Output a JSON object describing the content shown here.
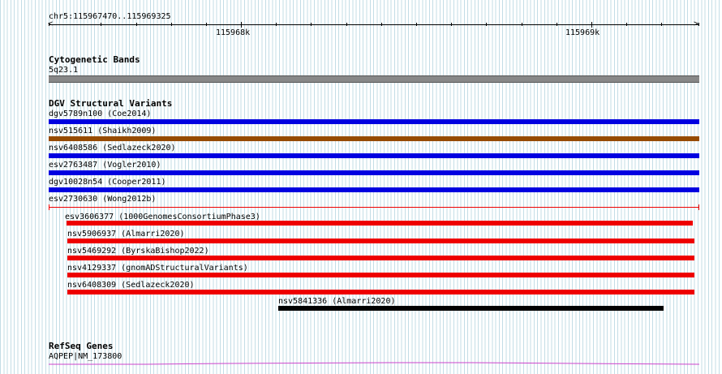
{
  "locus": "chr5:115967470..115969325",
  "ruler": {
    "labels": [
      "115968k",
      "115969k"
    ]
  },
  "tracks": {
    "cytoband": {
      "title": "Cytogenetic Bands",
      "band": "5q23.1",
      "band_color": "#888888"
    },
    "dgv": {
      "title": "DGV Structural Variants",
      "items": [
        {
          "label": "dgv5789n100 (Coe2014)",
          "color": "#0000e0"
        },
        {
          "label": "nsv515611 (Shaikh2009)",
          "color": "#964b00"
        },
        {
          "label": "nsv6408586 (Sedlazeck2020)",
          "color": "#0000e0"
        },
        {
          "label": "esv2763487 (Vogler2010)",
          "color": "#0000e0"
        },
        {
          "label": "dgv10028n54 (Cooper2011)",
          "color": "#0000e0"
        },
        {
          "label": "esv2730630 (Wong2012b)",
          "color": "#0000e0"
        }
      ],
      "red_items": [
        {
          "label": "esv3606377 (1000GenomesConsortiumPhase3)",
          "color": "#ee0000"
        },
        {
          "label": "nsv5906937 (Almarri2020)",
          "color": "#ee0000"
        },
        {
          "label": "nsv5469292 (ByrskaBishop2022)",
          "color": "#ee0000"
        },
        {
          "label": "nsv4129337 (gnomADStructuralVariants)",
          "color": "#ee0000"
        },
        {
          "label": "nsv6408309 (Sedlazeck2020)",
          "color": "#ee0000"
        }
      ],
      "black_item": {
        "label": "nsv5841336 (Almarri2020)",
        "color": "#000000"
      }
    },
    "refseq": {
      "title": "RefSeq Genes",
      "gene": "AQPEP|NM_173800",
      "gene_color": "#cc44cc"
    }
  }
}
